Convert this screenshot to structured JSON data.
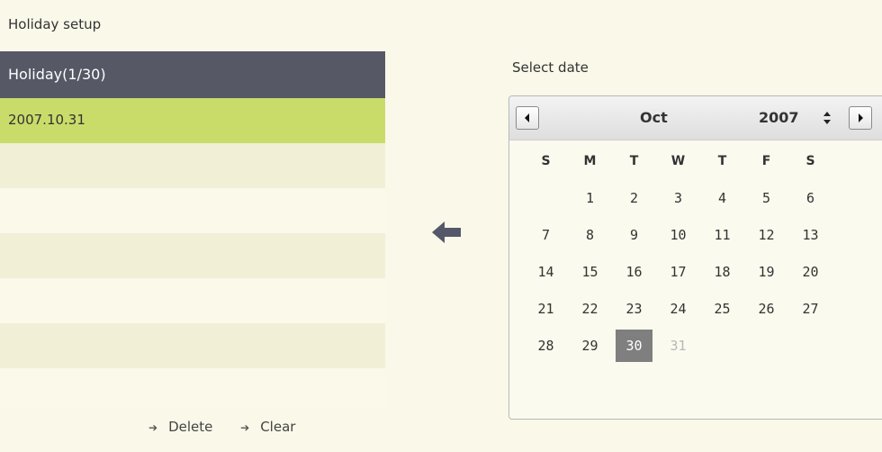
{
  "page": {
    "title": "Holiday setup"
  },
  "holiday_list": {
    "header": "Holiday(1/30)",
    "items": [
      "2007.10.31",
      "",
      "",
      "",
      "",
      "",
      ""
    ],
    "actions": {
      "delete_label": "Delete",
      "clear_label": "Clear"
    }
  },
  "date_picker": {
    "label": "Select date",
    "month": "Oct",
    "year": "2007",
    "weekdays": [
      "S",
      "M",
      "T",
      "W",
      "T",
      "F",
      "S"
    ],
    "weeks": [
      [
        "",
        "1",
        "2",
        "3",
        "4",
        "5",
        "6"
      ],
      [
        "7",
        "8",
        "9",
        "10",
        "11",
        "12",
        "13"
      ],
      [
        "14",
        "15",
        "16",
        "17",
        "18",
        "19",
        "20"
      ],
      [
        "21",
        "22",
        "23",
        "24",
        "25",
        "26",
        "27"
      ],
      [
        "28",
        "29",
        "30",
        "31",
        "",
        "",
        ""
      ]
    ],
    "selected_day": "30",
    "disabled_days": [
      "31"
    ]
  },
  "colors": {
    "background": "#f9f8e9",
    "header_bg": "#565866",
    "selected_row": "#c9dc6a",
    "selected_day": "#7f7f7f"
  }
}
